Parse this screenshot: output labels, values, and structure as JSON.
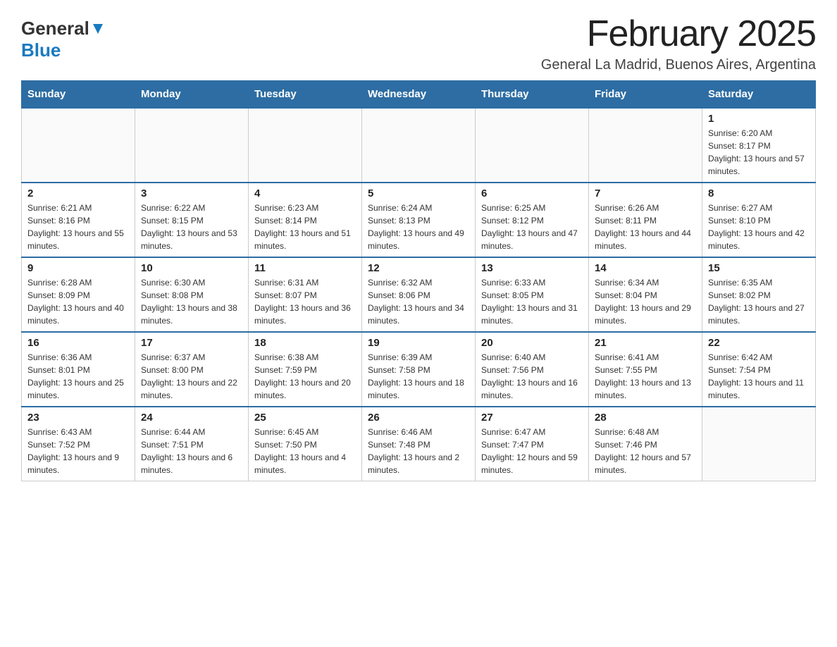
{
  "header": {
    "logo_general": "General",
    "logo_blue": "Blue",
    "month_title": "February 2025",
    "location": "General La Madrid, Buenos Aires, Argentina"
  },
  "calendar": {
    "days_of_week": [
      "Sunday",
      "Monday",
      "Tuesday",
      "Wednesday",
      "Thursday",
      "Friday",
      "Saturday"
    ],
    "weeks": [
      [
        {
          "day": "",
          "info": ""
        },
        {
          "day": "",
          "info": ""
        },
        {
          "day": "",
          "info": ""
        },
        {
          "day": "",
          "info": ""
        },
        {
          "day": "",
          "info": ""
        },
        {
          "day": "",
          "info": ""
        },
        {
          "day": "1",
          "info": "Sunrise: 6:20 AM\nSunset: 8:17 PM\nDaylight: 13 hours and 57 minutes."
        }
      ],
      [
        {
          "day": "2",
          "info": "Sunrise: 6:21 AM\nSunset: 8:16 PM\nDaylight: 13 hours and 55 minutes."
        },
        {
          "day": "3",
          "info": "Sunrise: 6:22 AM\nSunset: 8:15 PM\nDaylight: 13 hours and 53 minutes."
        },
        {
          "day": "4",
          "info": "Sunrise: 6:23 AM\nSunset: 8:14 PM\nDaylight: 13 hours and 51 minutes."
        },
        {
          "day": "5",
          "info": "Sunrise: 6:24 AM\nSunset: 8:13 PM\nDaylight: 13 hours and 49 minutes."
        },
        {
          "day": "6",
          "info": "Sunrise: 6:25 AM\nSunset: 8:12 PM\nDaylight: 13 hours and 47 minutes."
        },
        {
          "day": "7",
          "info": "Sunrise: 6:26 AM\nSunset: 8:11 PM\nDaylight: 13 hours and 44 minutes."
        },
        {
          "day": "8",
          "info": "Sunrise: 6:27 AM\nSunset: 8:10 PM\nDaylight: 13 hours and 42 minutes."
        }
      ],
      [
        {
          "day": "9",
          "info": "Sunrise: 6:28 AM\nSunset: 8:09 PM\nDaylight: 13 hours and 40 minutes."
        },
        {
          "day": "10",
          "info": "Sunrise: 6:30 AM\nSunset: 8:08 PM\nDaylight: 13 hours and 38 minutes."
        },
        {
          "day": "11",
          "info": "Sunrise: 6:31 AM\nSunset: 8:07 PM\nDaylight: 13 hours and 36 minutes."
        },
        {
          "day": "12",
          "info": "Sunrise: 6:32 AM\nSunset: 8:06 PM\nDaylight: 13 hours and 34 minutes."
        },
        {
          "day": "13",
          "info": "Sunrise: 6:33 AM\nSunset: 8:05 PM\nDaylight: 13 hours and 31 minutes."
        },
        {
          "day": "14",
          "info": "Sunrise: 6:34 AM\nSunset: 8:04 PM\nDaylight: 13 hours and 29 minutes."
        },
        {
          "day": "15",
          "info": "Sunrise: 6:35 AM\nSunset: 8:02 PM\nDaylight: 13 hours and 27 minutes."
        }
      ],
      [
        {
          "day": "16",
          "info": "Sunrise: 6:36 AM\nSunset: 8:01 PM\nDaylight: 13 hours and 25 minutes."
        },
        {
          "day": "17",
          "info": "Sunrise: 6:37 AM\nSunset: 8:00 PM\nDaylight: 13 hours and 22 minutes."
        },
        {
          "day": "18",
          "info": "Sunrise: 6:38 AM\nSunset: 7:59 PM\nDaylight: 13 hours and 20 minutes."
        },
        {
          "day": "19",
          "info": "Sunrise: 6:39 AM\nSunset: 7:58 PM\nDaylight: 13 hours and 18 minutes."
        },
        {
          "day": "20",
          "info": "Sunrise: 6:40 AM\nSunset: 7:56 PM\nDaylight: 13 hours and 16 minutes."
        },
        {
          "day": "21",
          "info": "Sunrise: 6:41 AM\nSunset: 7:55 PM\nDaylight: 13 hours and 13 minutes."
        },
        {
          "day": "22",
          "info": "Sunrise: 6:42 AM\nSunset: 7:54 PM\nDaylight: 13 hours and 11 minutes."
        }
      ],
      [
        {
          "day": "23",
          "info": "Sunrise: 6:43 AM\nSunset: 7:52 PM\nDaylight: 13 hours and 9 minutes."
        },
        {
          "day": "24",
          "info": "Sunrise: 6:44 AM\nSunset: 7:51 PM\nDaylight: 13 hours and 6 minutes."
        },
        {
          "day": "25",
          "info": "Sunrise: 6:45 AM\nSunset: 7:50 PM\nDaylight: 13 hours and 4 minutes."
        },
        {
          "day": "26",
          "info": "Sunrise: 6:46 AM\nSunset: 7:48 PM\nDaylight: 13 hours and 2 minutes."
        },
        {
          "day": "27",
          "info": "Sunrise: 6:47 AM\nSunset: 7:47 PM\nDaylight: 12 hours and 59 minutes."
        },
        {
          "day": "28",
          "info": "Sunrise: 6:48 AM\nSunset: 7:46 PM\nDaylight: 12 hours and 57 minutes."
        },
        {
          "day": "",
          "info": ""
        }
      ]
    ]
  }
}
